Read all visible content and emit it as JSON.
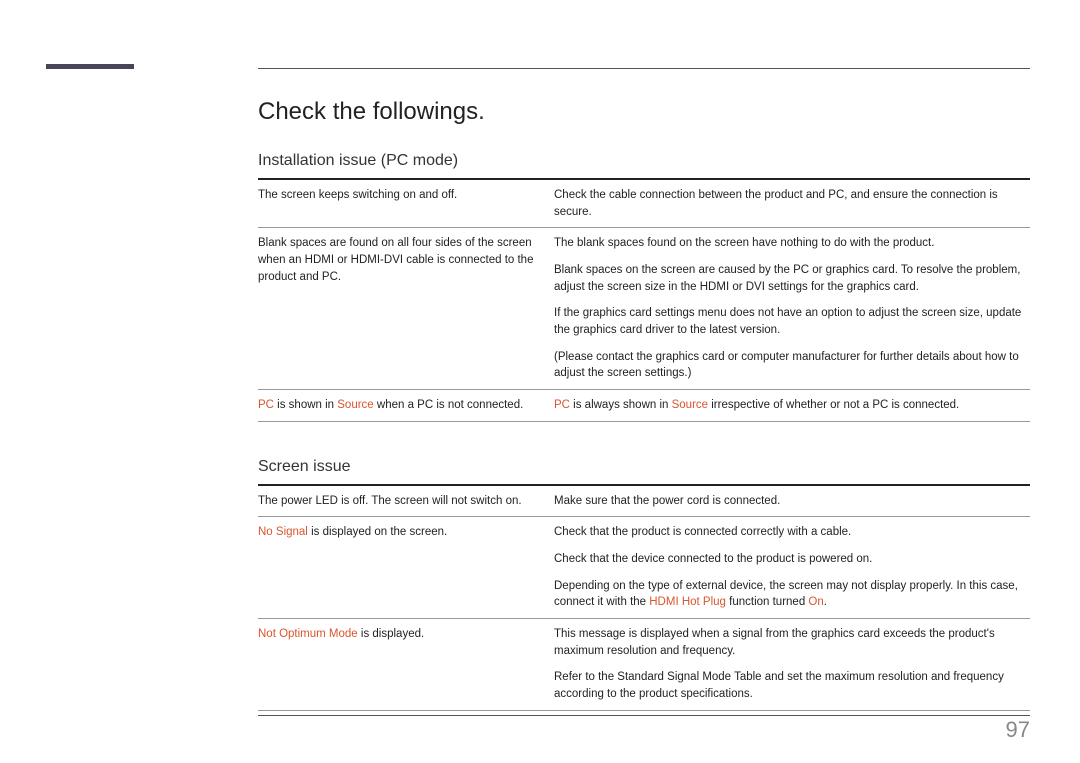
{
  "pageTitle": "Check the followings.",
  "pageNumber": "97",
  "section1": {
    "title": "Installation issue (PC mode)",
    "row1_left": "The screen keeps switching on and off.",
    "row1_right": "Check the cable connection between the product and PC, and ensure the connection is secure.",
    "row2_left": "Blank spaces are found on all four sides of the screen when an HDMI or HDMI-DVI cable is connected to the product and PC.",
    "row2_right_p1": "The blank spaces found on the screen have nothing to do with the product.",
    "row2_right_p2": "Blank spaces on the screen are caused by the PC or graphics card. To resolve the problem, adjust the screen size in the HDMI or DVI settings for the graphics card.",
    "row2_right_p3": "If the graphics card settings menu does not have an option to adjust the screen size, update the graphics card driver to the latest version.",
    "row2_right_p4": "(Please contact the graphics card or computer manufacturer for further details about how to adjust the screen settings.)",
    "row3_left_hl1": "PC",
    "row3_left_t1": " is shown in ",
    "row3_left_hl2": "Source",
    "row3_left_t2": " when a PC is not connected.",
    "row3_right_hl1": "PC",
    "row3_right_t1": " is always shown in ",
    "row3_right_hl2": "Source",
    "row3_right_t2": " irrespective of whether or not a PC is connected."
  },
  "section2": {
    "title": "Screen issue",
    "row1_left": "The power LED is off. The screen will not switch on.",
    "row1_right": "Make sure that the power cord is connected.",
    "row2_left_hl": "No Signal",
    "row2_left_t": " is displayed on the screen.",
    "row2_right_p1": "Check that the product is connected correctly with a cable.",
    "row2_right_p2": "Check that the device connected to the product is powered on.",
    "row2_right_p3a": "Depending on the type of external device, the screen may not display properly. In this case, connect it with the ",
    "row2_right_p3_hl1": "HDMI Hot Plug",
    "row2_right_p3b": " function turned ",
    "row2_right_p3_hl2": "On",
    "row2_right_p3c": ".",
    "row3_left_hl": "Not Optimum Mode",
    "row3_left_t": " is displayed.",
    "row3_right_p1": "This message is displayed when a signal from the graphics card exceeds the product's maximum resolution and frequency.",
    "row3_right_p2": "Refer to the Standard Signal Mode Table and set the maximum resolution and frequency according to the product specifications."
  }
}
